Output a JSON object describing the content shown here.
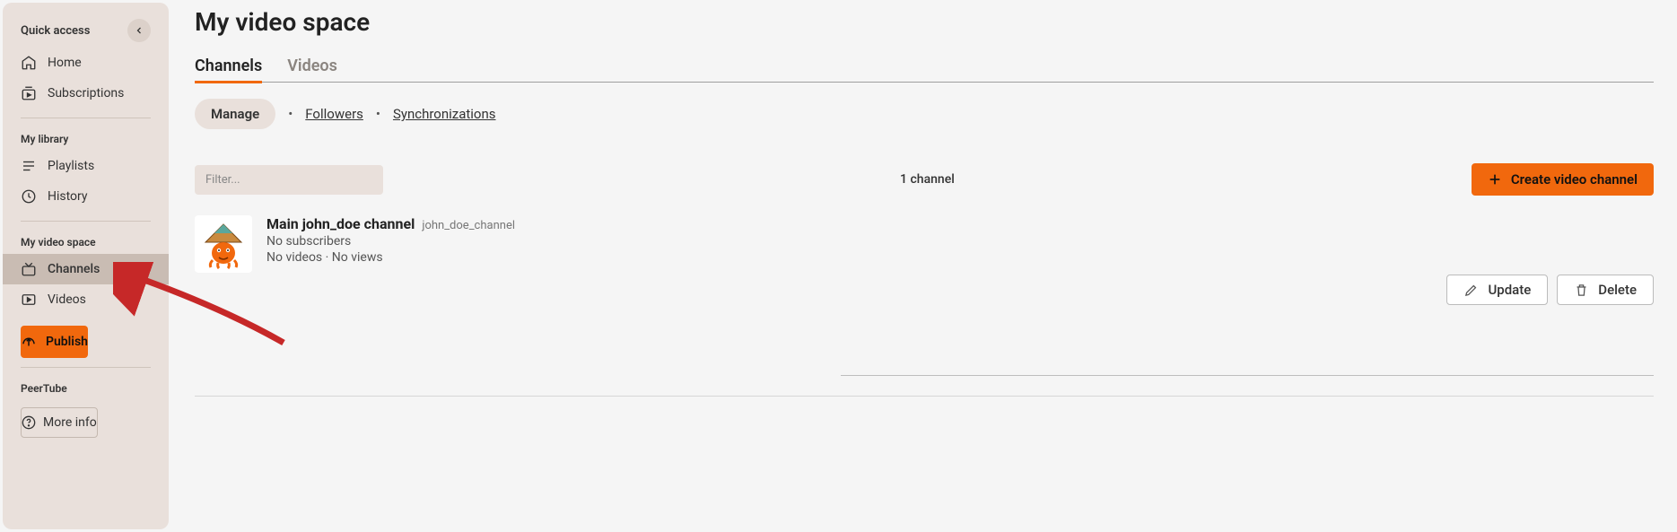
{
  "sidebar": {
    "quick_access_label": "Quick access",
    "home": "Home",
    "subscriptions": "Subscriptions",
    "my_library_label": "My library",
    "playlists": "Playlists",
    "history": "History",
    "my_video_space_label": "My video space",
    "channels": "Channels",
    "videos": "Videos",
    "publish": "Publish",
    "peertube_label": "PeerTube",
    "more_info": "More info"
  },
  "page": {
    "title": "My video space",
    "tabs": {
      "channels": "Channels",
      "videos": "Videos"
    },
    "subtabs": {
      "manage": "Manage",
      "followers": "Followers",
      "syncs": "Synchronizations"
    },
    "filter_placeholder": "Filter...",
    "channel_count": "1 channel",
    "create_btn": "Create video channel"
  },
  "channel": {
    "name": "Main john_doe channel",
    "handle": "john_doe_channel",
    "subscribers": "No subscribers",
    "stats": "No videos · No views",
    "update": "Update",
    "delete": "Delete"
  }
}
